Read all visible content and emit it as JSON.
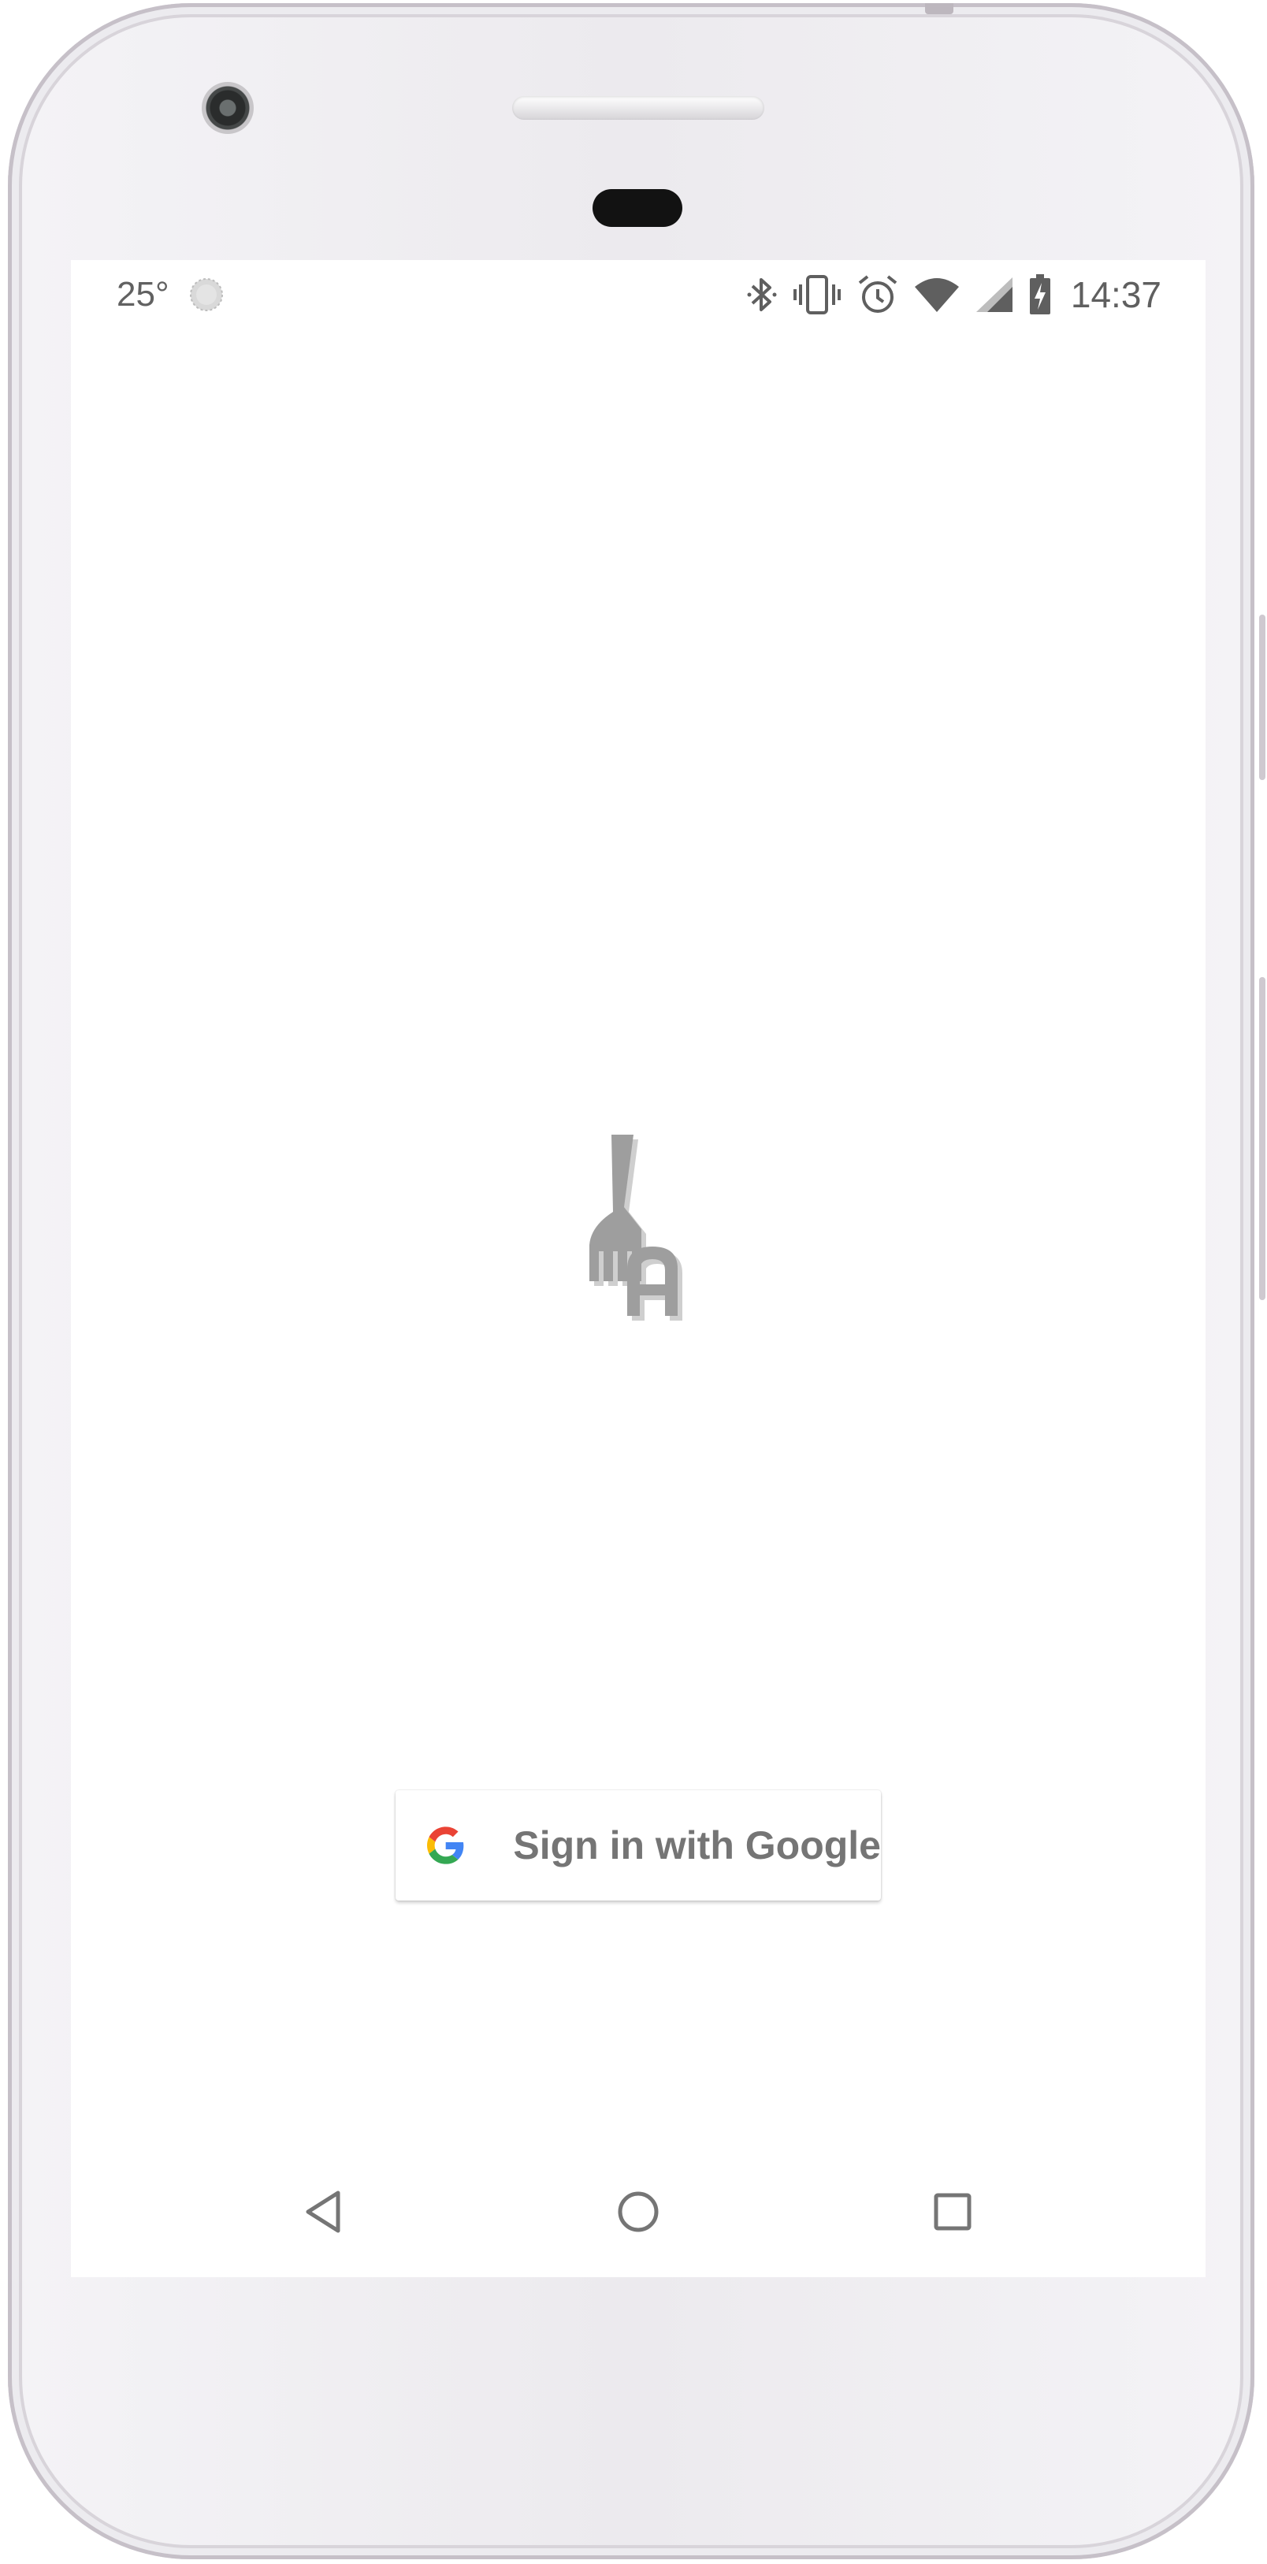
{
  "status_bar": {
    "temperature": "25°",
    "weather_icon": "weather-sun-icon",
    "icons": [
      "bluetooth-icon",
      "vibrate-icon",
      "alarm-icon",
      "wifi-icon",
      "cell-signal-icon",
      "battery-charging-icon"
    ],
    "time": "14:37"
  },
  "app": {
    "logo_icon": "fork-a-logo-icon"
  },
  "signin": {
    "label": "Sign in with Google",
    "icon": "google-g-icon"
  },
  "navigation": {
    "back_icon": "back-triangle-icon",
    "home_icon": "home-circle-icon",
    "recents_icon": "recents-square-icon"
  },
  "colors": {
    "screen_background": "#ffffff",
    "status_text": "#5f5f5f",
    "logo_gray": "#9e9e9e",
    "button_text": "#757575",
    "google_blue": "#4285F4",
    "google_red": "#EA4335",
    "google_yellow": "#FBBC05",
    "google_green": "#34A853"
  }
}
